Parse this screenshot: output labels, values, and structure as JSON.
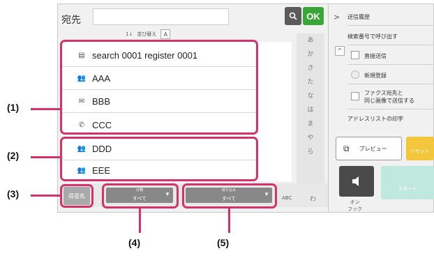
{
  "address_book": {
    "dest_label": "宛先",
    "search_placeholder": "",
    "ok_label": "OK",
    "sort_label": "並び替え",
    "sort_icon_label": "A"
  },
  "entries": [
    {
      "icon": "email-book-icon",
      "label": "search 0001 register 0001"
    },
    {
      "icon": "group-icon",
      "label": "AAA"
    },
    {
      "icon": "mail-icon",
      "label": "BBB"
    },
    {
      "icon": "phone-icon",
      "label": "CCC"
    },
    {
      "icon": "group-icon",
      "label": "DDD"
    },
    {
      "icon": "group-icon",
      "label": "EEE"
    }
  ],
  "kana_index": [
    "あ",
    "か",
    "さ",
    "た",
    "な",
    "は",
    "ま",
    "や",
    "ら"
  ],
  "bottom_bar": {
    "favorites_label": "得意先",
    "category_label": "分類",
    "category_value": "すべて",
    "filter_label": "絞り込み",
    "filter_value": "すべて",
    "abc_label": "ABC",
    "wa_label": "わ"
  },
  "right_panel": {
    "history_label": "送信履歴",
    "search_number_label": "検索番号で呼び出す",
    "direct_send_label": "直接送信",
    "new_register_label": "新規登録",
    "fax_same_image_label_1": "ファクス宛先と",
    "fax_same_image_label_2": "同じ画像で送信する",
    "print_list_label": "アドレスリストの印字",
    "preview_label": "プレビュー",
    "reset_label": "リセット",
    "onhook_label_1": "オン",
    "onhook_label_2": "フック",
    "start_label": "スタート"
  },
  "callouts": [
    "(1)",
    "(2)",
    "(3)",
    "(4)",
    "(5)"
  ],
  "colors": {
    "accent": "#d3336a",
    "ok": "#3aa63a",
    "start": "#bfe9de",
    "reset": "#f3c63b"
  }
}
